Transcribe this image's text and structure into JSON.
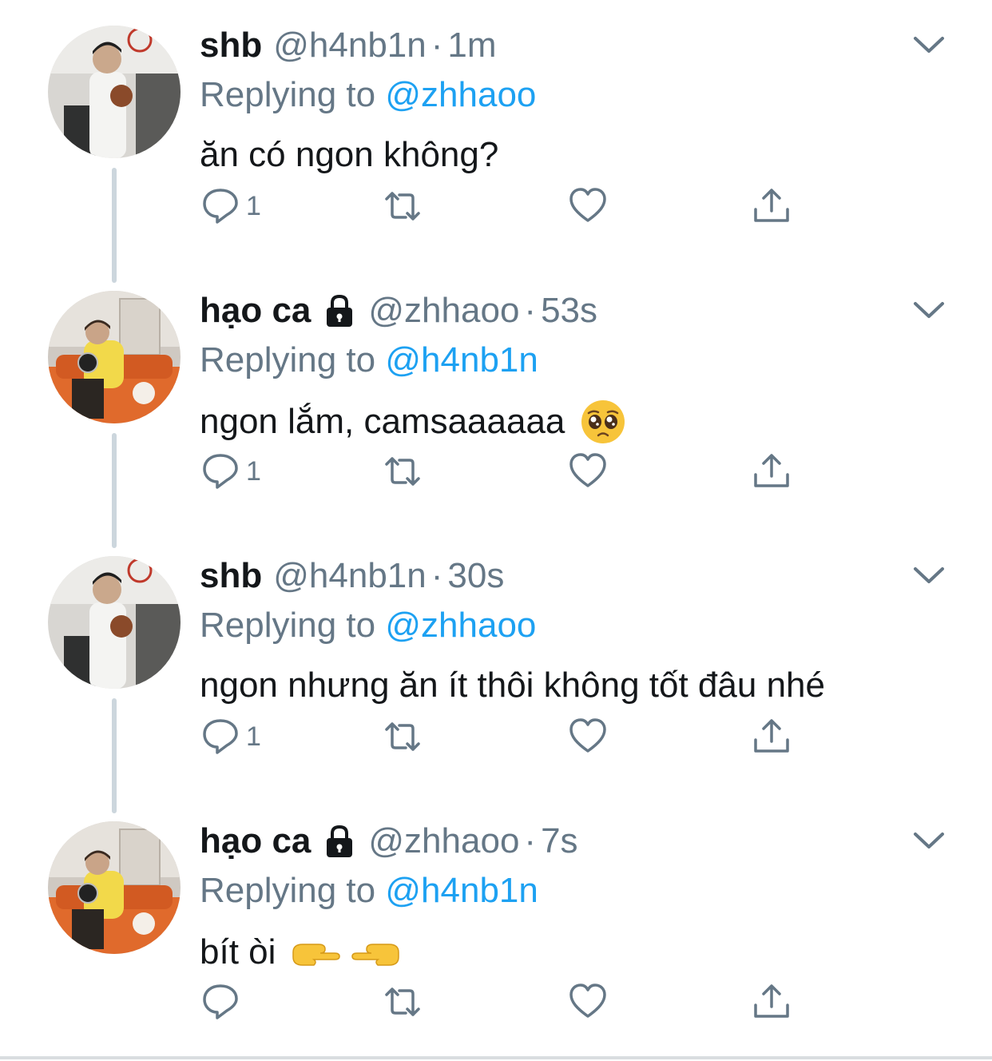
{
  "colors": {
    "text": "#14171a",
    "muted": "#657786",
    "link": "#1da1f2",
    "thread_line": "#ccd6dd"
  },
  "tweets": [
    {
      "name": "shb",
      "locked": false,
      "handle": "@h4nb1n",
      "dot": "·",
      "time": "1m",
      "replying_prefix": "Replying to",
      "replying_to": "@zhhaoo",
      "text": "ăn có ngon không?",
      "emoji": "",
      "reply_count": "1",
      "avatar": "shb-avatar"
    },
    {
      "name": "hạo ca",
      "locked": true,
      "handle": "@zhhaoo",
      "dot": "·",
      "time": "53s",
      "replying_prefix": "Replying to",
      "replying_to": "@h4nb1n",
      "text": "ngon lắm, camsaaaaaa",
      "emoji": "pleading-face-emoji",
      "reply_count": "1",
      "avatar": "haoca-avatar"
    },
    {
      "name": "shb",
      "locked": false,
      "handle": "@h4nb1n",
      "dot": "·",
      "time": "30s",
      "replying_prefix": "Replying to",
      "replying_to": "@zhhaoo",
      "text": "ngon nhưng ăn ít thôi không tốt đâu nhé",
      "emoji": "",
      "reply_count": "1",
      "avatar": "shb-avatar"
    },
    {
      "name": "hạo ca",
      "locked": true,
      "handle": "@zhhaoo",
      "dot": "·",
      "time": "7s",
      "replying_prefix": "Replying to",
      "replying_to": "@h4nb1n",
      "text": "bít òi",
      "emoji": "pointing-fingers-emoji",
      "reply_count": "",
      "avatar": "haoca-avatar"
    }
  ],
  "icons": {
    "reply": "reply-icon",
    "retweet": "retweet-icon",
    "like": "heart-icon",
    "share": "share-icon",
    "menu": "chevron-down-icon",
    "lock": "lock-icon"
  }
}
